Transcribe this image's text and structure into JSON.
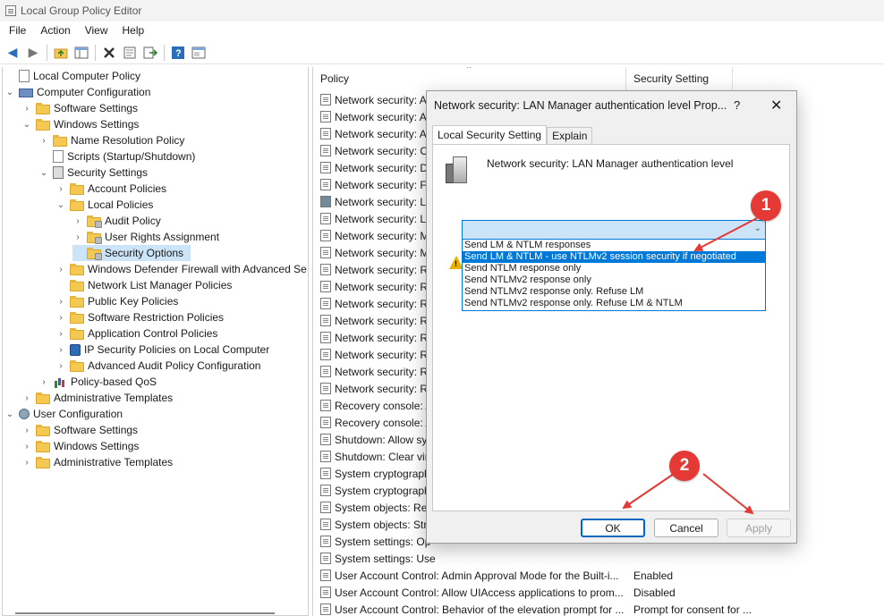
{
  "window": {
    "title": "Local Group Policy Editor"
  },
  "menu": [
    "File",
    "Action",
    "View",
    "Help"
  ],
  "toolbar_icons": [
    "back-icon",
    "forward-icon",
    "up-folder-icon",
    "show-hide-tree-icon",
    "delete-icon",
    "properties-icon",
    "export-icon",
    "help-icon",
    "filter-icon"
  ],
  "tree": [
    {
      "label": "Local Computer Policy",
      "icon": "policy-icon"
    },
    {
      "label": "Computer Configuration",
      "icon": "computer-icon"
    },
    {
      "label": "Software Settings",
      "icon": "folder-icon"
    },
    {
      "label": "Windows Settings",
      "icon": "folder-icon"
    },
    {
      "label": "Name Resolution Policy",
      "icon": "folder-icon"
    },
    {
      "label": "Scripts (Startup/Shutdown)",
      "icon": "script-icon"
    },
    {
      "label": "Security Settings",
      "icon": "security-icon"
    },
    {
      "label": "Account Policies",
      "icon": "folder-icon"
    },
    {
      "label": "Local Policies",
      "icon": "folder-icon"
    },
    {
      "label": "Audit Policy",
      "icon": "lock-folder-icon"
    },
    {
      "label": "User Rights Assignment",
      "icon": "lock-folder-icon"
    },
    {
      "label": "Security Options",
      "icon": "lock-folder-icon"
    },
    {
      "label": "Windows Defender Firewall with Advanced Se",
      "icon": "folder-icon"
    },
    {
      "label": "Network List Manager Policies",
      "icon": "folder-icon"
    },
    {
      "label": "Public Key Policies",
      "icon": "folder-icon"
    },
    {
      "label": "Software Restriction Policies",
      "icon": "folder-icon"
    },
    {
      "label": "Application Control Policies",
      "icon": "folder-icon"
    },
    {
      "label": "IP Security Policies on Local Computer",
      "icon": "ip-security-icon"
    },
    {
      "label": "Advanced Audit Policy Configuration",
      "icon": "folder-icon"
    },
    {
      "label": "Policy-based QoS",
      "icon": "qos-chart-icon"
    },
    {
      "label": "Administrative Templates",
      "icon": "folder-icon"
    },
    {
      "label": "User Configuration",
      "icon": "user-icon"
    },
    {
      "label": "Software Settings",
      "icon": "folder-icon"
    },
    {
      "label": "Windows Settings",
      "icon": "folder-icon"
    },
    {
      "label": "Administrative Templates",
      "icon": "folder-icon"
    }
  ],
  "list": {
    "col_policy": "Policy",
    "col_setting": "Security Setting",
    "rows": [
      {
        "policy": "Network security: A",
        "setting": ""
      },
      {
        "policy": "Network security: A",
        "setting": ""
      },
      {
        "policy": "Network security: A",
        "setting": ""
      },
      {
        "policy": "Network security: C",
        "setting": ""
      },
      {
        "policy": "Network security: D",
        "setting": ""
      },
      {
        "policy": "Network security: Fo",
        "setting": ""
      },
      {
        "policy": "Network security: La",
        "setting": ""
      },
      {
        "policy": "Network security: LI",
        "setting": ""
      },
      {
        "policy": "Network security: M",
        "setting": ""
      },
      {
        "policy": "Network security: M",
        "setting": ""
      },
      {
        "policy": "Network security: R",
        "setting": ""
      },
      {
        "policy": "Network security: R",
        "setting": ""
      },
      {
        "policy": "Network security: R",
        "setting": ""
      },
      {
        "policy": "Network security: R",
        "setting": ""
      },
      {
        "policy": "Network security: R",
        "setting": ""
      },
      {
        "policy": "Network security: R",
        "setting": ""
      },
      {
        "policy": "Network security: R",
        "setting": ""
      },
      {
        "policy": "Network security: R",
        "setting": ""
      },
      {
        "policy": "Recovery console: A",
        "setting": ""
      },
      {
        "policy": "Recovery console: A",
        "setting": ""
      },
      {
        "policy": "Shutdown: Allow sy",
        "setting": ""
      },
      {
        "policy": "Shutdown: Clear vir",
        "setting": ""
      },
      {
        "policy": "System cryptograph",
        "setting": ""
      },
      {
        "policy": "System cryptograph",
        "setting": ""
      },
      {
        "policy": "System objects: Rec",
        "setting": ""
      },
      {
        "policy": "System objects: Stre",
        "setting": ""
      },
      {
        "policy": "System settings: Op",
        "setting": ""
      },
      {
        "policy": "System settings: Use",
        "setting": ""
      },
      {
        "policy": "User Account Control: Admin Approval Mode for the Built-i...",
        "setting": "Enabled"
      },
      {
        "policy": "User Account Control: Allow UIAccess applications to prom...",
        "setting": "Disabled"
      },
      {
        "policy": "User Account Control: Behavior of the elevation prompt for ...",
        "setting": "Prompt for consent for ..."
      },
      {
        "policy": "User Account Control: Behavior of the elevation prompt for ...",
        "setting": "Prompt for credentials"
      }
    ]
  },
  "dialog": {
    "title": "Network security: LAN Manager authentication level Prop...",
    "help": "?",
    "close": "✕",
    "tabs": [
      "Local Security Setting",
      "Explain"
    ],
    "heading": "Network security: LAN Manager authentication level",
    "dropdown_options": [
      "Send LM & NTLM responses",
      "Send LM & NTLM - use NTLMv2 session security if negotiated",
      "Send NTLM response only",
      "Send NTLMv2 response only",
      "Send NTLMv2 response only. Refuse LM",
      "Send NTLMv2 response only. Refuse LM & NTLM"
    ],
    "selected_index": 1,
    "warning_mark": "!",
    "buttons": {
      "ok": "OK",
      "cancel": "Cancel",
      "apply": "Apply"
    }
  },
  "annotations": {
    "one": "1",
    "two": "2"
  },
  "colors": {
    "annotation": "#e53935",
    "selection": "#0078d7",
    "highlight": "#cce4f7"
  }
}
